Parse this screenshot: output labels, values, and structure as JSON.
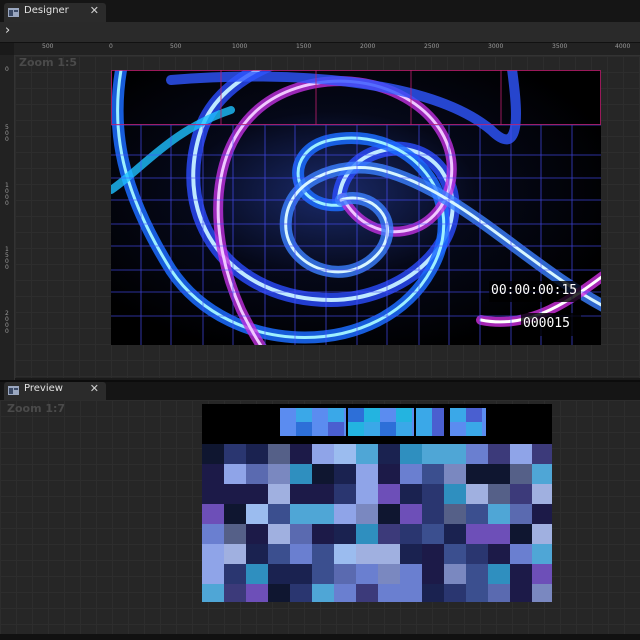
{
  "designer": {
    "tab_label": "Designer",
    "zoom_label": "Zoom 1:5",
    "ruler_h": [
      "500",
      "0",
      "500",
      "1000",
      "1500",
      "2000",
      "2500",
      "3000",
      "3500",
      "4000"
    ],
    "ruler_v": [
      "0",
      "500",
      "1000",
      "1500",
      "2000"
    ],
    "timecode": "00:00:00:15",
    "frame_count": "000015"
  },
  "preview": {
    "tab_label": "Preview",
    "zoom_label": "Zoom 1:7"
  },
  "icons": {
    "close": "close-icon",
    "expand": "chevron-right-icon",
    "tab": "window-icon"
  },
  "colors": {
    "accent_blue": "#3a5cff",
    "magenta": "#d020e0",
    "cyan": "#40e0ff"
  }
}
